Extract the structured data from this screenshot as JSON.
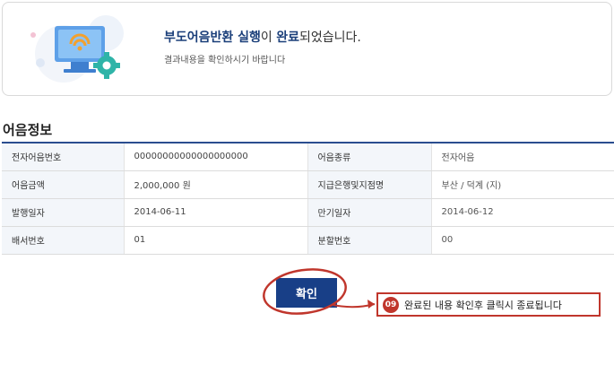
{
  "result": {
    "title_part1": "부도어음반환 실행",
    "title_part2": "이 ",
    "title_part3": "완료",
    "title_part4": "되었습니다.",
    "subtitle": "결과내용을 확인하시기 바랍니다"
  },
  "section": {
    "title": "어음정보"
  },
  "table": {
    "rows": [
      {
        "l1": "전자어음번호",
        "v1": "00000000000000000000",
        "l2": "어음종류",
        "v2": "전자어음"
      },
      {
        "l1": "어음금액",
        "v1": "2,000,000 원",
        "l2": "지급은행및지점명",
        "v2": "부산 / 덕계 (지)"
      },
      {
        "l1": "발행일자",
        "v1": "2014-06-11",
        "l2": "만기일자",
        "v2": "2014-06-12"
      },
      {
        "l1": "배서번호",
        "v1": "01",
        "l2": "분할번호",
        "v2": "00"
      }
    ]
  },
  "confirm_button": {
    "label": "확인"
  },
  "callout": {
    "number": "09",
    "text": "완료된 내용 확인후 클릭시 종료됩니다"
  },
  "colors": {
    "navy": "#183f87",
    "annotation_red": "#c0362c"
  }
}
